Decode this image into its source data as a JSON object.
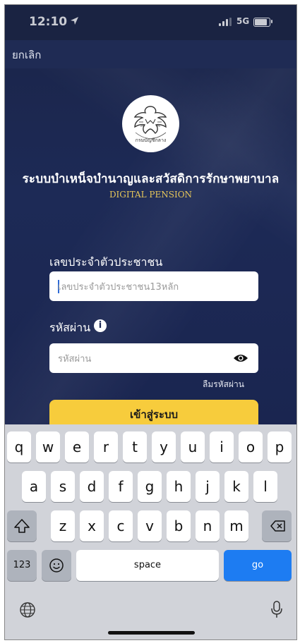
{
  "status_bar": {
    "time": "12:10",
    "network": "5G"
  },
  "nav": {
    "cancel": "ยกเลิก"
  },
  "header": {
    "title": "ระบบบำเหน็จบำนาญและสวัสดิการรักษาพยาบาล",
    "subtitle": "DIGITAL PENSION",
    "logo_text": "กรมบัญชีกลาง"
  },
  "form": {
    "id_label": "เลขประจำตัวประชาชน",
    "id_placeholder": "เลขประจำตัวประชาชน13หลัก",
    "password_label": "รหัสผ่าน",
    "password_placeholder": "รหัสผ่าน",
    "forgot": "ลืมรหัสผ่าน",
    "login": "เข้าสู่ระบบ"
  },
  "keyboard": {
    "row1": [
      "q",
      "w",
      "e",
      "r",
      "t",
      "y",
      "u",
      "i",
      "o",
      "p"
    ],
    "row2": [
      "a",
      "s",
      "d",
      "f",
      "g",
      "h",
      "j",
      "k",
      "l"
    ],
    "row3": [
      "z",
      "x",
      "c",
      "v",
      "b",
      "n",
      "m"
    ],
    "numbers": "123",
    "space": "space",
    "go": "go"
  },
  "colors": {
    "accent": "#f7cc3c",
    "background": "#1d2a56",
    "go_key": "#1d7cf2"
  }
}
